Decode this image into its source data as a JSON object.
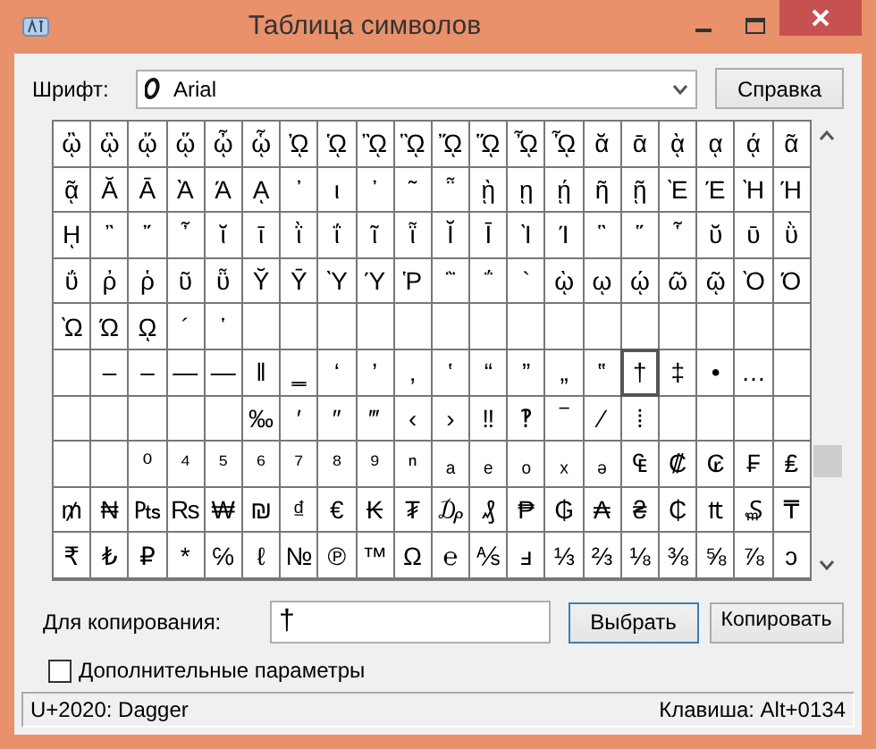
{
  "window": {
    "title": "Таблица символов"
  },
  "font": {
    "label": "Шрифт:",
    "value": "Arial"
  },
  "help_button": "Справка",
  "grid": {
    "rows": [
      [
        {
          "char": "ᾢ",
          "selected": false
        },
        {
          "char": "ᾣ",
          "selected": false
        },
        {
          "char": "ᾤ",
          "selected": false
        },
        {
          "char": "ᾥ",
          "selected": false
        },
        {
          "char": "ᾦ",
          "selected": false
        },
        {
          "char": "ᾧ",
          "selected": false
        },
        {
          "char": "ᾨ",
          "selected": false
        },
        {
          "char": "ᾩ",
          "selected": false
        },
        {
          "char": "ᾪ",
          "selected": false
        },
        {
          "char": "ᾫ",
          "selected": false
        },
        {
          "char": "ᾬ",
          "selected": false
        },
        {
          "char": "ᾭ",
          "selected": false
        },
        {
          "char": "ᾮ",
          "selected": false
        },
        {
          "char": "ᾯ",
          "selected": false
        },
        {
          "char": "ᾰ",
          "selected": false
        },
        {
          "char": "ᾱ",
          "selected": false
        },
        {
          "char": "ᾲ",
          "selected": false
        },
        {
          "char": "ᾳ",
          "selected": false
        },
        {
          "char": "ᾴ",
          "selected": false
        },
        {
          "char": "ᾶ",
          "selected": false
        }
      ],
      [
        {
          "char": "ᾷ",
          "selected": false
        },
        {
          "char": "Ᾰ",
          "selected": false
        },
        {
          "char": "Ᾱ",
          "selected": false
        },
        {
          "char": "Ὰ",
          "selected": false
        },
        {
          "char": "Ά",
          "selected": false
        },
        {
          "char": "ᾼ",
          "selected": false
        },
        {
          "char": "᾽",
          "selected": false
        },
        {
          "char": "ι",
          "selected": false
        },
        {
          "char": "᾿",
          "selected": false
        },
        {
          "char": "῀",
          "selected": false
        },
        {
          "char": "῁",
          "selected": false
        },
        {
          "char": "ῂ",
          "selected": false
        },
        {
          "char": "ῃ",
          "selected": false
        },
        {
          "char": "ῄ",
          "selected": false
        },
        {
          "char": "ῆ",
          "selected": false
        },
        {
          "char": "ῇ",
          "selected": false
        },
        {
          "char": "Ὲ",
          "selected": false
        },
        {
          "char": "Έ",
          "selected": false
        },
        {
          "char": "Ὴ",
          "selected": false
        },
        {
          "char": "Ή",
          "selected": false
        }
      ],
      [
        {
          "char": "ῌ",
          "selected": false
        },
        {
          "char": "῍",
          "selected": false
        },
        {
          "char": "῎",
          "selected": false
        },
        {
          "char": "῏",
          "selected": false
        },
        {
          "char": "ῐ",
          "selected": false
        },
        {
          "char": "ῑ",
          "selected": false
        },
        {
          "char": "ῒ",
          "selected": false
        },
        {
          "char": "ΐ",
          "selected": false
        },
        {
          "char": "ῖ",
          "selected": false
        },
        {
          "char": "ῗ",
          "selected": false
        },
        {
          "char": "Ῐ",
          "selected": false
        },
        {
          "char": "Ῑ",
          "selected": false
        },
        {
          "char": "Ὶ",
          "selected": false
        },
        {
          "char": "Ί",
          "selected": false
        },
        {
          "char": "῝",
          "selected": false
        },
        {
          "char": "῞",
          "selected": false
        },
        {
          "char": "῟",
          "selected": false
        },
        {
          "char": "ῠ",
          "selected": false
        },
        {
          "char": "ῡ",
          "selected": false
        },
        {
          "char": "ῢ",
          "selected": false
        }
      ],
      [
        {
          "char": "ΰ",
          "selected": false
        },
        {
          "char": "ῤ",
          "selected": false
        },
        {
          "char": "ῥ",
          "selected": false
        },
        {
          "char": "ῦ",
          "selected": false
        },
        {
          "char": "ῧ",
          "selected": false
        },
        {
          "char": "Ῠ",
          "selected": false
        },
        {
          "char": "Ῡ",
          "selected": false
        },
        {
          "char": "Ὺ",
          "selected": false
        },
        {
          "char": "Ύ",
          "selected": false
        },
        {
          "char": "Ῥ",
          "selected": false
        },
        {
          "char": "῭",
          "selected": false
        },
        {
          "char": "΅",
          "selected": false
        },
        {
          "char": "`",
          "selected": false
        },
        {
          "char": "ῲ",
          "selected": false
        },
        {
          "char": "ῳ",
          "selected": false
        },
        {
          "char": "ῴ",
          "selected": false
        },
        {
          "char": "ῶ",
          "selected": false
        },
        {
          "char": "ῷ",
          "selected": false
        },
        {
          "char": "Ὸ",
          "selected": false
        },
        {
          "char": "Ό",
          "selected": false
        }
      ],
      [
        {
          "char": "Ὼ",
          "selected": false
        },
        {
          "char": "Ώ",
          "selected": false
        },
        {
          "char": "ῼ",
          "selected": false
        },
        {
          "char": "´",
          "selected": false
        },
        {
          "char": "῾",
          "selected": false
        },
        {
          "selected": false
        },
        {
          "selected": false
        },
        {
          "selected": false
        },
        {
          "selected": false
        },
        {
          "selected": false
        },
        {
          "selected": false
        },
        {
          "selected": false
        },
        {
          "selected": false
        },
        {
          "selected": false
        },
        {
          "selected": false
        },
        {
          "selected": false
        },
        {
          "selected": false
        },
        {
          "selected": false
        },
        {
          "selected": false
        },
        {
          "selected": false
        }
      ],
      [
        {
          "selected": false
        },
        {
          "char": "‒",
          "selected": false
        },
        {
          "char": "–",
          "selected": false
        },
        {
          "char": "—",
          "selected": false
        },
        {
          "char": "―",
          "selected": false
        },
        {
          "char": "‖",
          "selected": false
        },
        {
          "char": "‗",
          "selected": false
        },
        {
          "char": "‘",
          "selected": false
        },
        {
          "char": "’",
          "selected": false
        },
        {
          "char": "‚",
          "selected": false
        },
        {
          "char": "‛",
          "selected": false
        },
        {
          "char": "“",
          "selected": false
        },
        {
          "char": "”",
          "selected": false
        },
        {
          "char": "„",
          "selected": false
        },
        {
          "char": "‟",
          "selected": false
        },
        {
          "char": "†",
          "selected": true
        },
        {
          "char": "‡",
          "selected": false
        },
        {
          "char": "•",
          "selected": false
        },
        {
          "char": "…",
          "selected": false
        },
        {
          "selected": false
        }
      ],
      [
        {
          "selected": false
        },
        {
          "selected": false
        },
        {
          "selected": false
        },
        {
          "selected": false
        },
        {
          "selected": false
        },
        {
          "char": "‰",
          "selected": false
        },
        {
          "char": "′",
          "selected": false
        },
        {
          "char": "″",
          "selected": false
        },
        {
          "char": "‴",
          "selected": false
        },
        {
          "char": "‹",
          "selected": false
        },
        {
          "char": "›",
          "selected": false
        },
        {
          "char": "‼",
          "selected": false
        },
        {
          "char": "‽",
          "selected": false
        },
        {
          "char": "‾",
          "selected": false
        },
        {
          "char": "⁄",
          "selected": false
        },
        {
          "char": "⁞",
          "selected": false
        },
        {
          "selected": false
        },
        {
          "selected": false
        },
        {
          "selected": false
        },
        {
          "selected": false
        }
      ],
      [
        {
          "selected": false
        },
        {
          "selected": false
        },
        {
          "char": "⁰",
          "selected": false
        },
        {
          "char": "⁴",
          "selected": false
        },
        {
          "char": "⁵",
          "selected": false
        },
        {
          "char": "⁶",
          "selected": false
        },
        {
          "char": "⁷",
          "selected": false
        },
        {
          "char": "⁸",
          "selected": false
        },
        {
          "char": "⁹",
          "selected": false
        },
        {
          "char": "ⁿ",
          "selected": false
        },
        {
          "char": "ₐ",
          "selected": false
        },
        {
          "char": "ₑ",
          "selected": false
        },
        {
          "char": "ₒ",
          "selected": false
        },
        {
          "char": "ₓ",
          "selected": false
        },
        {
          "char": "ₔ",
          "selected": false
        },
        {
          "char": "₠",
          "selected": false
        },
        {
          "char": "₡",
          "selected": false
        },
        {
          "char": "₢",
          "selected": false
        },
        {
          "char": "₣",
          "selected": false
        },
        {
          "char": "₤",
          "selected": false
        }
      ],
      [
        {
          "char": "₥",
          "selected": false
        },
        {
          "char": "₦",
          "selected": false
        },
        {
          "char": "₧",
          "selected": false
        },
        {
          "char": "₨",
          "selected": false
        },
        {
          "char": "₩",
          "selected": false
        },
        {
          "char": "₪",
          "selected": false
        },
        {
          "char": "₫",
          "selected": false
        },
        {
          "char": "€",
          "selected": false
        },
        {
          "char": "₭",
          "selected": false
        },
        {
          "char": "₮",
          "selected": false
        },
        {
          "char": "₯",
          "selected": false
        },
        {
          "char": "₰",
          "selected": false
        },
        {
          "char": "₱",
          "selected": false
        },
        {
          "char": "₲",
          "selected": false
        },
        {
          "char": "₳",
          "selected": false
        },
        {
          "char": "₴",
          "selected": false
        },
        {
          "char": "₵",
          "selected": false
        },
        {
          "char": "₶",
          "selected": false
        },
        {
          "char": "₷",
          "selected": false
        },
        {
          "char": "₸",
          "selected": false
        }
      ],
      [
        {
          "char": "₹",
          "selected": false
        },
        {
          "char": "₺",
          "selected": false
        },
        {
          "char": "₽",
          "selected": false
        },
        {
          "char": "*",
          "selected": false
        },
        {
          "char": "℅",
          "selected": false
        },
        {
          "char": "ℓ",
          "selected": false
        },
        {
          "char": "№",
          "selected": false
        },
        {
          "char": "℗",
          "selected": false
        },
        {
          "char": "™",
          "selected": false
        },
        {
          "char": "Ω",
          "selected": false
        },
        {
          "char": "℮",
          "selected": false
        },
        {
          "char": "⅍",
          "selected": false
        },
        {
          "char": "ⅎ",
          "selected": false
        },
        {
          "char": "⅓",
          "selected": false
        },
        {
          "char": "⅔",
          "selected": false
        },
        {
          "char": "⅛",
          "selected": false
        },
        {
          "char": "⅜",
          "selected": false
        },
        {
          "char": "⅝",
          "selected": false
        },
        {
          "char": "⅞",
          "selected": false
        },
        {
          "char": "ↄ",
          "selected": false
        }
      ]
    ]
  },
  "copy": {
    "label": "Для копирования:",
    "value": "†"
  },
  "select_button": "Выбрать",
  "copy_button": "Копировать",
  "advanced": {
    "label": "Дополнительные параметры",
    "checked": false
  },
  "status_bar": {
    "left": "U+2020: Dagger",
    "right": "Клавиша: Alt+0134"
  }
}
